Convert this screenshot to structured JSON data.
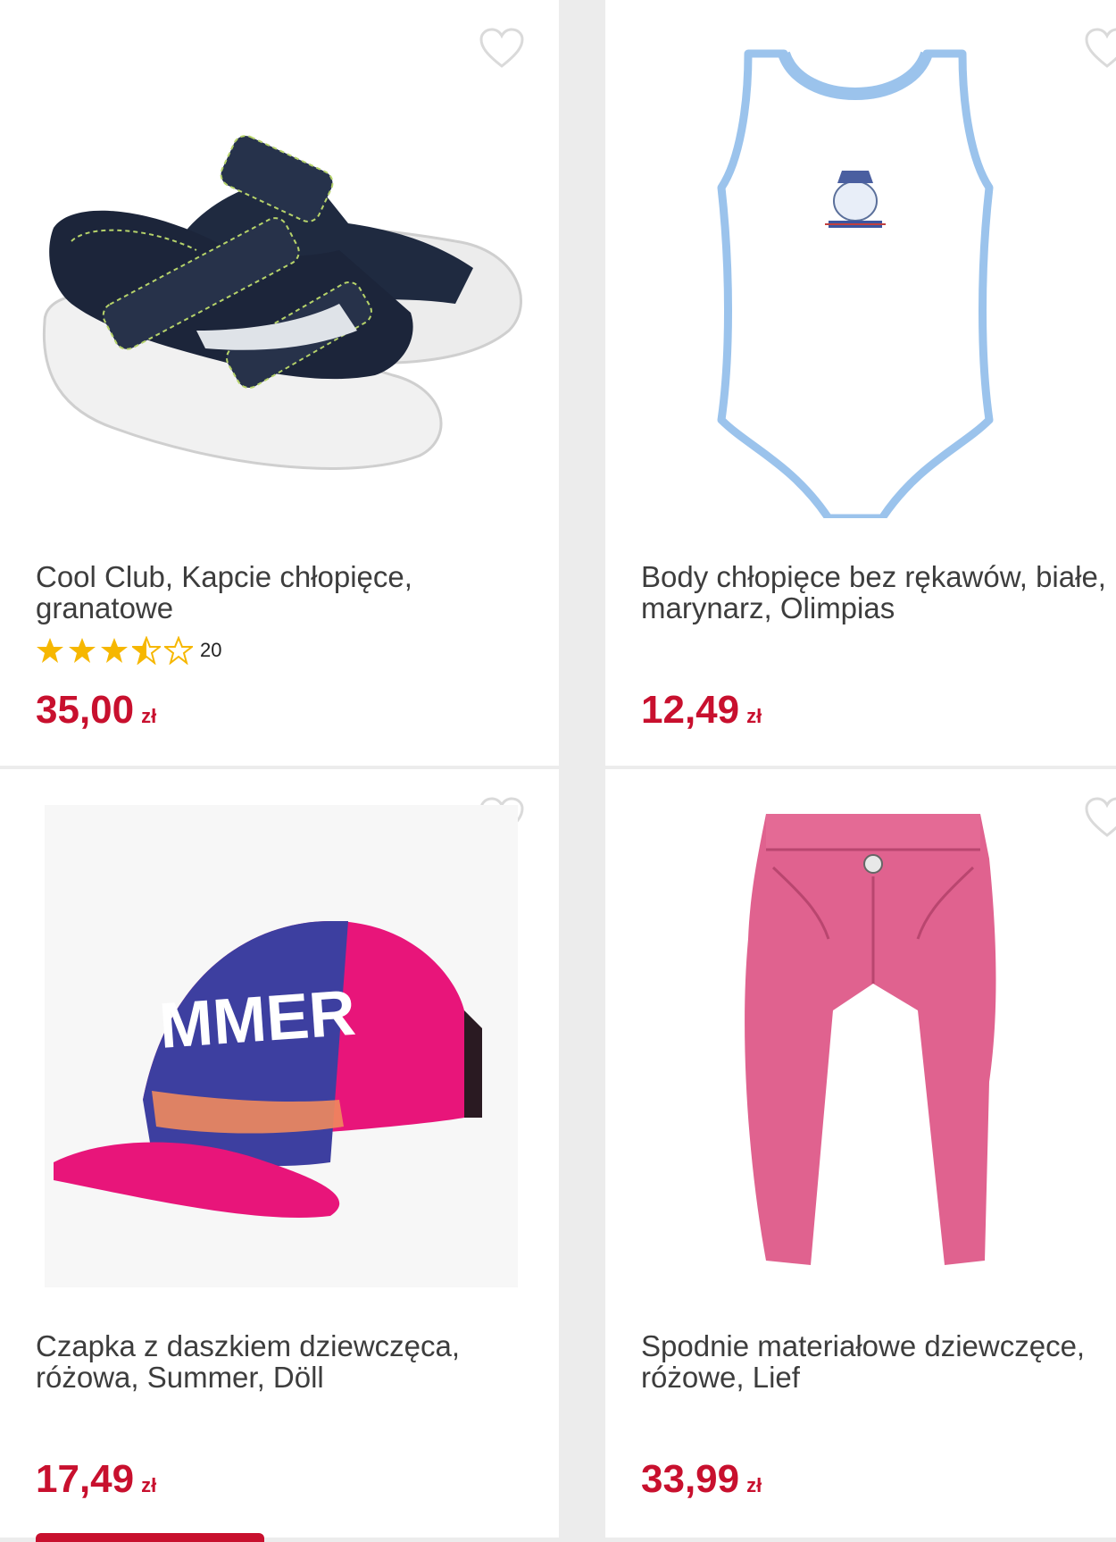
{
  "products": [
    {
      "title_line1": "Cool Club, Kapcie chłopięce,",
      "title_line2": "granatowe",
      "rating_value": 3.5,
      "rating_count": "20",
      "price": "35,00",
      "currency": "zł"
    },
    {
      "title_line1": "Body chłopięce bez rękawów, białe,",
      "title_line2": "marynarz, Olimpias",
      "price": "12,49",
      "currency": "zł"
    },
    {
      "title_line1": "Czapka z daszkiem dziewczęca,",
      "title_line2": "różowa, Summer, Döll",
      "cap_text": "MMER",
      "price": "17,49",
      "currency": "zł"
    },
    {
      "title_line1": "Spodnie materiałowe dziewczęce,",
      "title_line2": "różowe, Lief",
      "price": "33,99",
      "currency": "zł"
    }
  ],
  "colors": {
    "price": "#c8102e",
    "star": "#f6b700",
    "background": "#ececec"
  },
  "icons": {
    "wishlist": "heart-outline-icon",
    "rating": "star-icon"
  }
}
